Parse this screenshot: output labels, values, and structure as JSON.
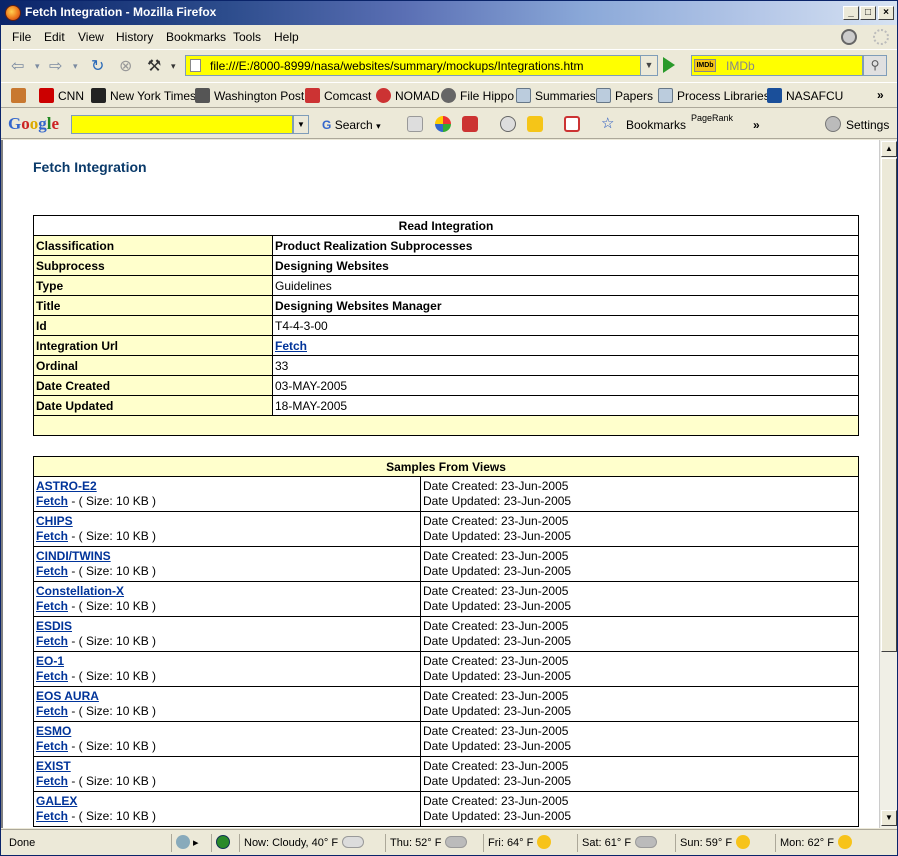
{
  "window": {
    "title": "Fetch Integration - Mozilla Firefox"
  },
  "menu": {
    "items": [
      "File",
      "Edit",
      "View",
      "History",
      "Bookmarks",
      "Tools",
      "Help"
    ]
  },
  "address": {
    "url": "file:///E:/8000-8999/nasa/websites/summary/mockups/Integrations.htm"
  },
  "search": {
    "placeholder": "IMDb",
    "engine_icon": "IMDb"
  },
  "bookmarks": {
    "items": [
      "CNN",
      "New York Times",
      "Washington Post",
      "Comcast",
      "NOMAD",
      "File Hippo",
      "Summaries",
      "Papers",
      "Process Libraries",
      "NASAFCU"
    ],
    "overflow": "»"
  },
  "google_toolbar": {
    "logo": [
      "G",
      "o",
      "o",
      "g",
      "l",
      "e"
    ],
    "search_label": "Search",
    "bookmarks_label": "Bookmarks",
    "pagerank_label": "PageRank",
    "more": "»",
    "settings_label": "Settings"
  },
  "page": {
    "title": "Fetch Integration",
    "read_integration": {
      "header": "Read Integration",
      "rows": [
        {
          "label": "Classification",
          "value": "Product Realization Subprocesses"
        },
        {
          "label": "Subprocess",
          "value": "Designing Websites"
        },
        {
          "label": "Type",
          "value": "Guidelines"
        },
        {
          "label": "Title",
          "value": "Designing Websites Manager"
        },
        {
          "label": "Id",
          "value": "T4-4-3-00"
        },
        {
          "label": "Integration Url",
          "value": "Fetch"
        },
        {
          "label": "Ordinal",
          "value": "33"
        },
        {
          "label": "Date Created",
          "value": "03-MAY-2005"
        },
        {
          "label": "Date Updated",
          "value": "18-MAY-2005"
        }
      ]
    },
    "samples": {
      "header": "Samples From Views",
      "fetch_label": "Fetch",
      "size_text": " - ( Size: 10 KB )",
      "rows": [
        {
          "name": "ASTRO-E2",
          "created": "Date Created: 23-Jun-2005",
          "updated": "Date Updated: 23-Jun-2005"
        },
        {
          "name": "CHIPS",
          "created": "Date Created: 23-Jun-2005",
          "updated": "Date Updated: 23-Jun-2005"
        },
        {
          "name": "CINDI/TWINS",
          "created": "Date Created: 23-Jun-2005",
          "updated": "Date Updated: 23-Jun-2005"
        },
        {
          "name": "Constellation-X",
          "created": "Date Created: 23-Jun-2005",
          "updated": "Date Updated: 23-Jun-2005"
        },
        {
          "name": "ESDIS",
          "created": "Date Created: 23-Jun-2005",
          "updated": "Date Updated: 23-Jun-2005"
        },
        {
          "name": "EO-1",
          "created": "Date Created: 23-Jun-2005",
          "updated": "Date Updated: 23-Jun-2005"
        },
        {
          "name": "EOS AURA",
          "created": "Date Created: 23-Jun-2005",
          "updated": "Date Updated: 23-Jun-2005"
        },
        {
          "name": "ESMO",
          "created": "Date Created: 23-Jun-2005",
          "updated": "Date Updated: 23-Jun-2005"
        },
        {
          "name": "EXIST",
          "created": "Date Created: 23-Jun-2005",
          "updated": "Date Updated: 23-Jun-2005"
        },
        {
          "name": "GALEX",
          "created": "Date Created: 23-Jun-2005",
          "updated": "Date Updated: 23-Jun-2005"
        }
      ]
    }
  },
  "status": {
    "text": "Done",
    "weather": [
      {
        "label": "Now: Cloudy, 40° F",
        "icon": "cloud-icon"
      },
      {
        "label": "Thu: 52° F",
        "icon": "rain-cloud-icon"
      },
      {
        "label": "Fri: 64° F",
        "icon": "partly-sunny-icon"
      },
      {
        "label": "Sat: 61° F",
        "icon": "rain-cloud-icon"
      },
      {
        "label": "Sun: 59° F",
        "icon": "partly-sunny-icon"
      },
      {
        "label": "Mon: 62° F",
        "icon": "partly-sunny-icon"
      }
    ]
  }
}
